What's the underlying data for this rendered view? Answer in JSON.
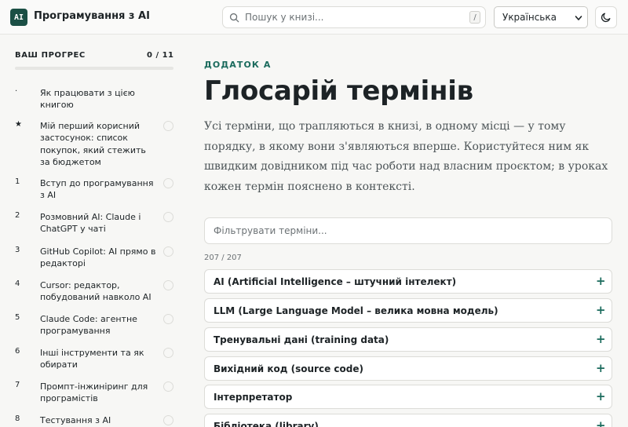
{
  "header": {
    "logo": "AI",
    "title": "Програмування з AI",
    "search_placeholder": "Пошук у книзі...",
    "search_shortcut": "/",
    "language": "Українська",
    "theme_icon": "moon-icon"
  },
  "sidebar": {
    "progress_label": "ВАШ ПРОГРЕС",
    "progress_count": "0 / 11",
    "progress_fraction": 0,
    "items": [
      {
        "num": "·",
        "label": "Як працювати з цією книгою",
        "check": false
      },
      {
        "num": "★",
        "label": "Мій перший корисний застосунок: список покупок, який стежить за бюджетом",
        "check": true
      },
      {
        "num": "1",
        "label": "Вступ до програмування з AI",
        "check": true
      },
      {
        "num": "2",
        "label": "Розмовний AI: Claude і ChatGPT у чаті",
        "check": true
      },
      {
        "num": "3",
        "label": "GitHub Copilot: AI прямо в редакторі",
        "check": true
      },
      {
        "num": "4",
        "label": "Cursor: редактор, побудований навколо AI",
        "check": true
      },
      {
        "num": "5",
        "label": "Claude Code: агентне програмування",
        "check": true
      },
      {
        "num": "6",
        "label": "Інші інструменти та як обирати",
        "check": true
      },
      {
        "num": "7",
        "label": "Промпт-інжиніринг для програмістів",
        "check": true
      },
      {
        "num": "8",
        "label": "Тестування з AI",
        "check": true
      }
    ]
  },
  "main": {
    "eyebrow": "ДОДАТОК А",
    "title": "Глосарій термінів",
    "intro": "Усі терміни, що трапляються в книзі, в одному місці — у тому порядку, в якому вони з'являються вперше. Користуйтеся ним як швидким довідником під час роботи над власним проєктом; в уроках кожен термін пояснено в контексті.",
    "filter_placeholder": "Фільтрувати терміни...",
    "count": "207 / 207",
    "expand_symbol": "+",
    "terms": [
      "AI (Artificial Intelligence – штучний інтелект)",
      "LLM (Large Language Model – велика мовна модель)",
      "Тренувальні дані (training data)",
      "Вихідний код (source code)",
      "Інтерпретатор",
      "Бібліотека (library)"
    ]
  }
}
